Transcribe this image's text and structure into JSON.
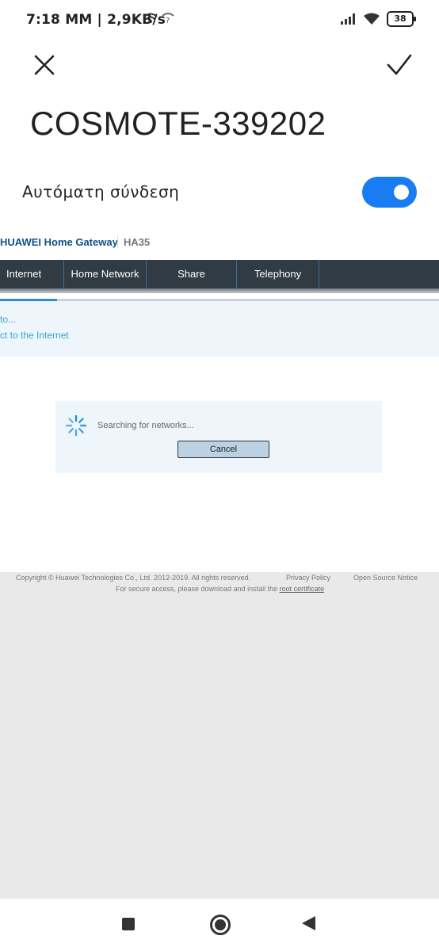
{
  "status_bar": {
    "time_speed": "7:18 MM | 2,9KB/s",
    "battery": "38",
    "icons": [
      "wifi-assist-icon",
      "wifi-question-icon",
      "signal-icon",
      "wifi-icon",
      "battery-icon"
    ]
  },
  "header": {
    "network_name": "COSMOTE-339202",
    "auto_connect_label": "Αυτόματη σύνδεση",
    "auto_connect_on": true,
    "accent_color": "#1a7cf2"
  },
  "web": {
    "brand": "HUAWEI Home Gateway",
    "model": "HA35",
    "nav_tabs": [
      "Internet",
      "Home Network",
      "Share",
      "Telephony"
    ],
    "progress_percent": 13,
    "info_line1": "to...",
    "info_line2": "ct to the Internet",
    "searching_text": "Searching for networks...",
    "cancel_label": "Cancel"
  },
  "footer": {
    "copyright": "Copyright © Huawei Technologies Co., Ltd. 2012-2019. All rights reserved.",
    "privacy": "Privacy Policy",
    "open_source": "Open Source Notice",
    "secure_prefix": "For secure access, please download and install the",
    "root_cert": "root certificate"
  }
}
